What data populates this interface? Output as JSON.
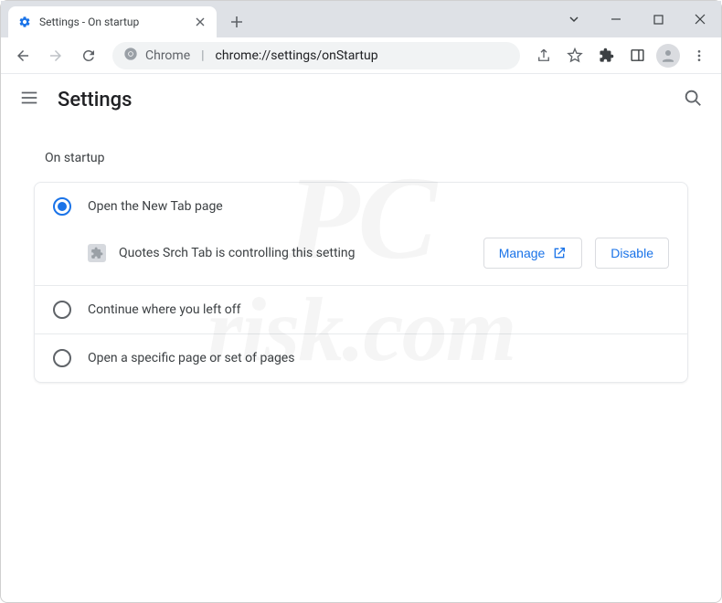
{
  "window": {
    "tab_title": "Settings - On startup"
  },
  "omnibox": {
    "scheme_label": "Chrome",
    "url_path": "chrome://settings/onStartup"
  },
  "appbar": {
    "title": "Settings"
  },
  "section": {
    "title": "On startup"
  },
  "options": {
    "open_new_tab": "Open the New Tab page",
    "continue": "Continue where you left off",
    "specific": "Open a specific page or set of pages"
  },
  "extension_notice": {
    "text": "Quotes Srch Tab is controlling this setting",
    "manage_label": "Manage",
    "disable_label": "Disable"
  },
  "watermark": {
    "line1": "PC",
    "line2": "risk.com"
  }
}
